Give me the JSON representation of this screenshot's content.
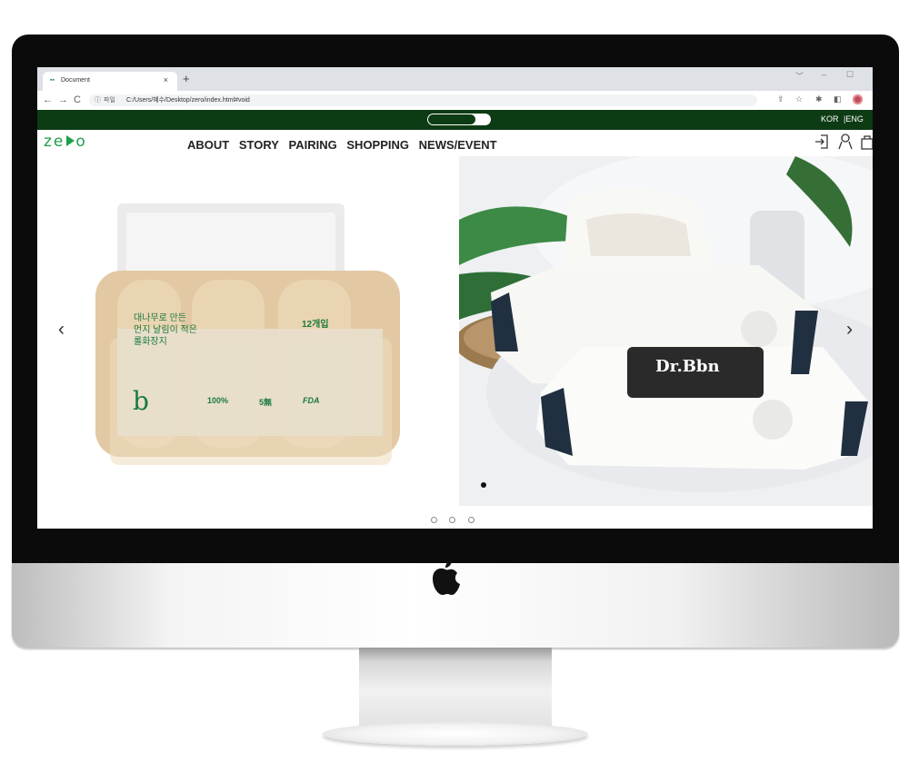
{
  "browser": {
    "tab_title": "Document",
    "tab_close": "×",
    "new_tab": "+",
    "url_info": "ⓘ",
    "url_protocol": "파일",
    "url_path": "C:/Users/혜수/Desktop/zero/index.html#void",
    "window_controls": [
      "﹀",
      "–",
      "☐"
    ]
  },
  "site": {
    "lang": {
      "kor": "KOR",
      "eng": "|ENG"
    },
    "brand": {
      "part1": "ze",
      "part2": "o"
    },
    "menu": [
      "ABOUT",
      "STORY",
      "PAIRING",
      "SHOPPING",
      "NEWS/EVENT"
    ],
    "header_icons": [
      "login-icon",
      "user-icon",
      "cart-icon"
    ],
    "slider": {
      "prev": "‹",
      "next": "›",
      "slide1": {
        "text_lines": [
          "대나무로 만든",
          "먼지 날림이 적은",
          "롤화장지"
        ],
        "count_label": "12개입",
        "stamp": "b",
        "badges": [
          "100%",
          "5無",
          "FDA"
        ]
      },
      "slide2": {
        "product_name": "Dr.Bbn"
      },
      "pagination_count": 3
    }
  },
  "colors": {
    "brand_green": "#1d9f4c",
    "dark_green": "#0d3b14"
  }
}
